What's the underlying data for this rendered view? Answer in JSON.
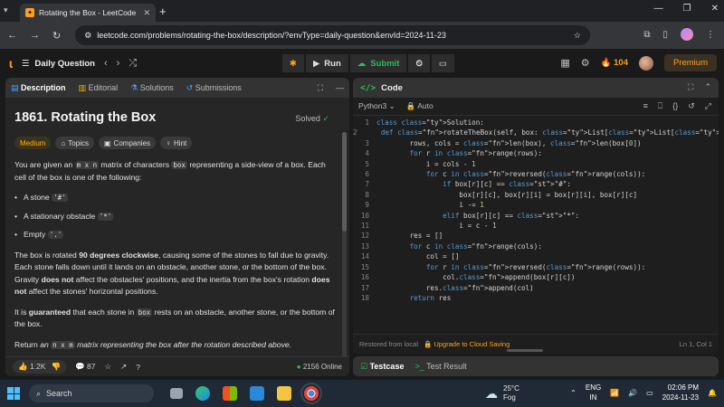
{
  "browser": {
    "tab_title": "Rotating the Box - LeetCode",
    "tab_favicon": "leetcode-favicon",
    "url": "leetcode.com/problems/rotating-the-box/description/?envType=daily-question&envId=2024-11-23"
  },
  "lc_header": {
    "title": "Daily Question",
    "run_label": "Run",
    "submit_label": "Submit",
    "streak": "104",
    "premium_label": "Premium"
  },
  "left_tabs": [
    "Description",
    "Editorial",
    "Solutions",
    "Submissions"
  ],
  "problem": {
    "title": "1861. Rotating the Box",
    "status": "Solved",
    "difficulty": "Medium",
    "tags": [
      "Topics",
      "Companies",
      "Hint"
    ],
    "p1_a": "You are given an ",
    "p1_code1": "m x n",
    "p1_b": " matrix of characters ",
    "p1_code2": "box",
    "p1_c": " representing a side-view of a box. Each cell of the box is one of the following:",
    "bullets": [
      {
        "text": "A stone ",
        "code": "'#'"
      },
      {
        "text": "A stationary obstacle ",
        "code": "'*'"
      },
      {
        "text": "Empty ",
        "code": "'.'"
      }
    ],
    "p2_a": "The box is rotated ",
    "p2_b": "90 degrees clockwise",
    "p2_c": ", causing some of the stones to fall due to gravity. Each stone falls down until it lands on an obstacle, another stone, or the bottom of the box. Gravity ",
    "p2_d": "does not",
    "p2_e": " affect the obstacles' positions, and the inertia from the box's rotation ",
    "p2_f": "does not",
    "p2_g": " affect the stones' horizontal positions.",
    "p3_a": "It is ",
    "p3_b": "guaranteed",
    "p3_c": " that each stone in ",
    "p3_code": "box",
    "p3_d": " rests on an obstacle, another stone, or the bottom of the box.",
    "p4_a": "Return ",
    "p4_b": "an ",
    "p4_code": "n x m",
    "p4_c": " matrix representing the box after the rotation described above."
  },
  "left_footer": {
    "likes": "1.2K",
    "comments": "87",
    "online": "2156 Online"
  },
  "code_panel": {
    "title": "Code",
    "language": "Python3",
    "mode": "Auto",
    "footer_left": "Restored from local",
    "footer_cloud": "Upgrade to Cloud Saving",
    "footer_pos": "Ln 1, Col 1"
  },
  "code_lines": [
    "class Solution:",
    "    def rotateTheBox(self, box: List[List[str]]) -> List[List[str]]:",
    "        rows, cols = len(box), len(box[0])",
    "        for r in range(rows):",
    "            i = cols - 1",
    "            for c in reversed(range(cols)):",
    "                if box[r][c] == \"#\":",
    "                    box[r][c], box[r][i] = box[r][i], box[r][c]",
    "                    i -= 1",
    "                elif box[r][c] == \"*\":",
    "                    i = c - 1",
    "        res = []",
    "        for c in range(cols):",
    "            col = []",
    "            for r in reversed(range(rows)):",
    "                col.append(box[r][c])",
    "            res.append(col)",
    "        return res"
  ],
  "test_panel": {
    "testcase": "Testcase",
    "result": "Test Result"
  },
  "taskbar": {
    "search_placeholder": "Search",
    "temperature": "25°C",
    "weather": "Fog",
    "lang_1": "ENG",
    "lang_2": "IN",
    "time": "02:06 PM",
    "date": "2024-11-23"
  }
}
